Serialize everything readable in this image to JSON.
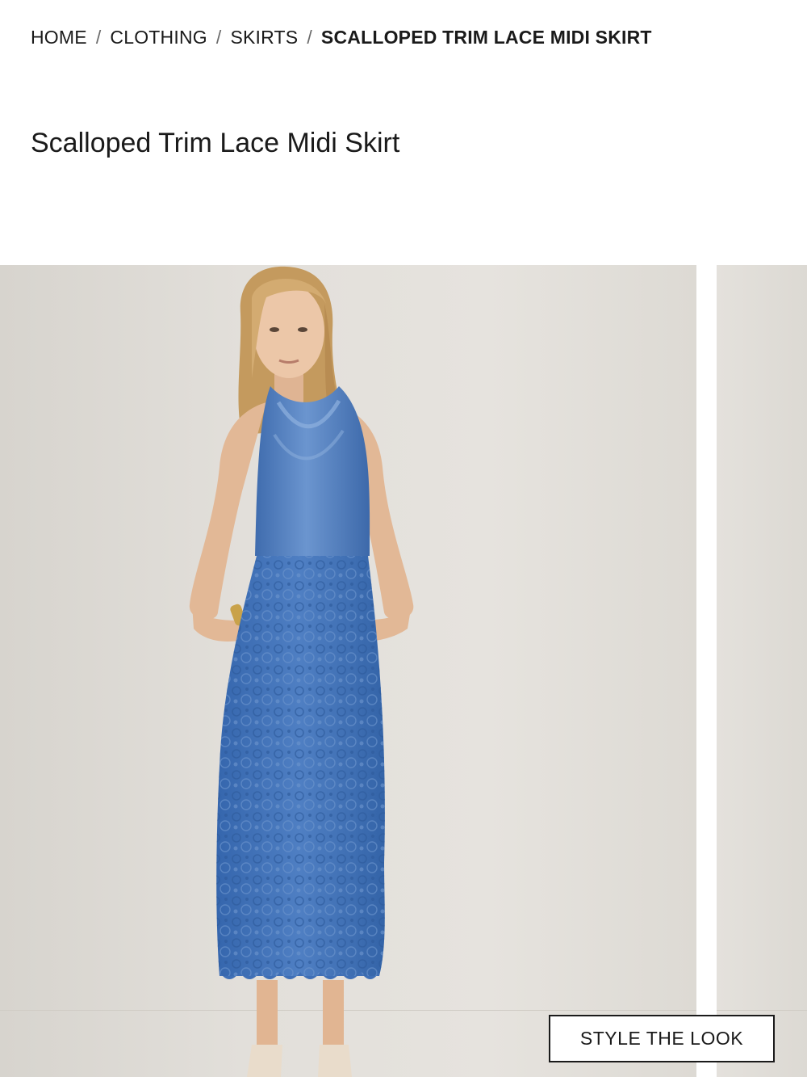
{
  "breadcrumb": {
    "items": [
      {
        "label": "HOME"
      },
      {
        "label": "CLOTHING"
      },
      {
        "label": "SKIRTS"
      }
    ],
    "separator": "/",
    "current": "SCALLOPED TRIM LACE MIDI SKIRT"
  },
  "product": {
    "title": "Scalloped Trim Lace Midi Skirt"
  },
  "gallery": {
    "cta_label": "STYLE THE LOOK",
    "colors": {
      "top": "#4f7ec0",
      "skirt": "#3f6fb6",
      "hair": "#c8a066",
      "skin": "#e8c3a4",
      "background": "#e2dfda"
    }
  }
}
